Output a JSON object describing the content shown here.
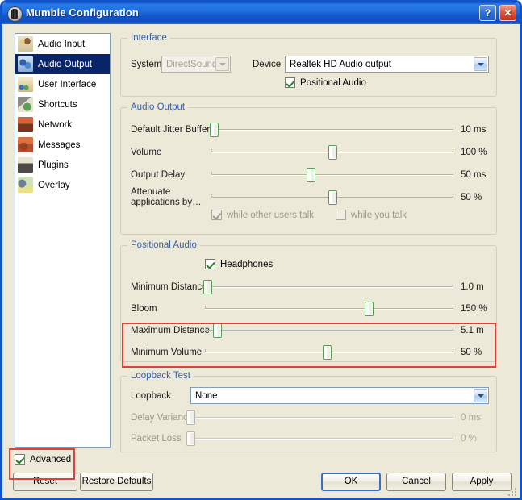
{
  "window": {
    "title": "Mumble Configuration",
    "icon": "mumble-logo-icon",
    "help_button": "?",
    "close_button": "✕"
  },
  "sidebar": {
    "items": [
      {
        "label": "Audio Input",
        "icon": "audio-input-icon",
        "selected": false
      },
      {
        "label": "Audio Output",
        "icon": "audio-output-icon",
        "selected": true
      },
      {
        "label": "User Interface",
        "icon": "user-interface-icon",
        "selected": false
      },
      {
        "label": "Shortcuts",
        "icon": "shortcuts-icon",
        "selected": false
      },
      {
        "label": "Network",
        "icon": "network-icon",
        "selected": false
      },
      {
        "label": "Messages",
        "icon": "messages-icon",
        "selected": false
      },
      {
        "label": "Plugins",
        "icon": "plugins-icon",
        "selected": false
      },
      {
        "label": "Overlay",
        "icon": "overlay-icon",
        "selected": false
      }
    ]
  },
  "interface_group": {
    "title": "Interface",
    "system_label": "System",
    "system_value": "DirectSound",
    "system_enabled": false,
    "device_label": "Device",
    "device_value": "Realtek HD Audio output",
    "device_enabled": true,
    "positional_audio_label": "Positional Audio",
    "positional_audio_checked": true
  },
  "audio_output_group": {
    "title": "Audio Output",
    "sliders": [
      {
        "label": "Default Jitter Buffer",
        "value": "10 ms",
        "pos_pct": 1,
        "enabled": true
      },
      {
        "label": "Volume",
        "value": "100 %",
        "pos_pct": 50,
        "enabled": true
      },
      {
        "label": "Output Delay",
        "value": "50 ms",
        "pos_pct": 41,
        "enabled": true
      },
      {
        "label": "Attenuate applications by…",
        "value": "50 %",
        "pos_pct": 50,
        "enabled": true
      }
    ],
    "checkboxes": [
      {
        "label": "while other users talk",
        "checked": true,
        "enabled": false
      },
      {
        "label": "while you talk",
        "checked": false,
        "enabled": false
      }
    ]
  },
  "positional_audio_group": {
    "title": "Positional Audio",
    "headphones_label": "Headphones",
    "headphones_checked": true,
    "sliders": [
      {
        "label": "Minimum Distance",
        "value": "1.0 m",
        "pos_pct": 1,
        "enabled": true
      },
      {
        "label": "Bloom",
        "value": "150 %",
        "pos_pct": 66,
        "enabled": true
      },
      {
        "label": "Maximum Distance",
        "value": "5.1 m",
        "pos_pct": 5,
        "enabled": true
      },
      {
        "label": "Minimum Volume",
        "value": "50 %",
        "pos_pct": 49,
        "enabled": true
      }
    ]
  },
  "loopback_group": {
    "title": "Loopback Test",
    "loopback_label": "Loopback",
    "loopback_value": "None",
    "sliders": [
      {
        "label": "Delay Variance",
        "value": "0 ms",
        "pos_pct": 0,
        "enabled": false
      },
      {
        "label": "Packet Loss",
        "value": "0 %",
        "pos_pct": 0,
        "enabled": false
      }
    ]
  },
  "footer": {
    "advanced_label": "Advanced",
    "advanced_checked": true,
    "reset_label": "Reset",
    "restore_defaults_label": "Restore Defaults",
    "ok_label": "OK",
    "cancel_label": "Cancel",
    "apply_label": "Apply"
  },
  "annotations": {
    "highlight_color": "#e0403a",
    "regions": [
      "positional-audio-distance-rows",
      "advanced-checkbox"
    ]
  }
}
